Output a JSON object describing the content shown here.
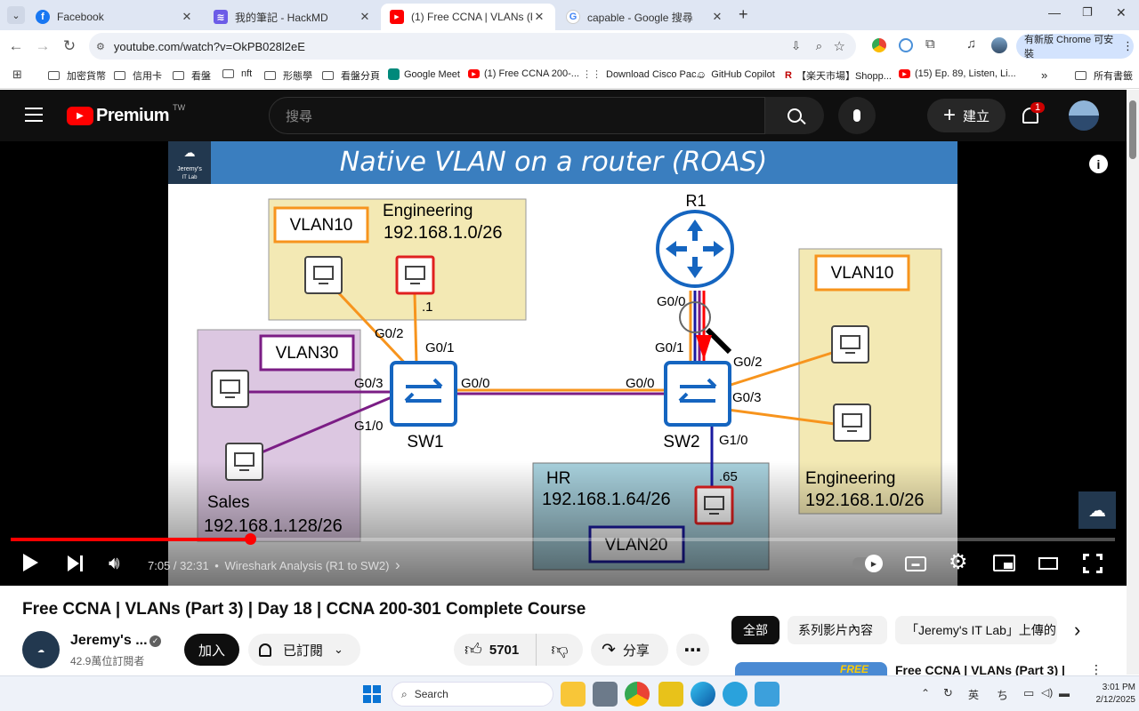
{
  "browser": {
    "tabs": [
      {
        "label": "Facebook",
        "color": "#1877f2",
        "glyph": "f"
      },
      {
        "label": "我的筆記 - HackMD",
        "color": "#6c5ce7",
        "glyph": "≋"
      },
      {
        "label": "(1) Free CCNA | VLANs (Part 3) |",
        "color": "#ff0000",
        "glyph": "▶"
      },
      {
        "label": "capable - Google 搜尋",
        "color": "#4285f4",
        "glyph": "G"
      }
    ],
    "url": "youtube.com/watch?v=OkPB028l2eE",
    "update_button": "有新版 Chrome 可安裝",
    "bookmarks": [
      "加密貨幣",
      "信用卡",
      "看盤",
      "nft",
      "形態學",
      "看盤分頁",
      "Google Meet",
      "(1) Free CCNA 200-...",
      "Download Cisco Pac...",
      "GitHub Copilot",
      "【楽天市場】Shopp...",
      "(15) Ep. 89, Listen, Li..."
    ],
    "all_bookmarks": "所有書籤",
    "more_chevron": "»"
  },
  "youtube": {
    "logo_text": "Premium",
    "region": "TW",
    "search_placeholder": "搜尋",
    "create_label": "建立",
    "notification_count": "1"
  },
  "slide": {
    "title": "Native VLAN on a router (ROAS)",
    "badge_line1": "Jeremy's",
    "badge_line2": "IT Lab",
    "router": "R1",
    "sw1": "SW1",
    "sw2": "SW2",
    "ports": {
      "r1_g00": "G0/0",
      "sw2_g01": "G0/1",
      "sw2_g02": "G0/2",
      "sw2_g03": "G0/3",
      "sw2_g10": "G1/0",
      "sw2_g00": "G0/0",
      "sw1_g00": "G0/0",
      "sw1_g02": "G0/2",
      "sw1_g01": "G0/1",
      "sw1_g03": "G0/3",
      "sw1_g10": "G1/0"
    },
    "eng_left": {
      "vlan": "VLAN10",
      "name": "Engineering",
      "subnet": "192.168.1.0/26",
      "host": ".1"
    },
    "sales": {
      "vlan": "VLAN30",
      "name": "Sales",
      "subnet": "192.168.1.128/26"
    },
    "eng_right": {
      "vlan": "VLAN10",
      "name": "Engineering",
      "subnet": "192.168.1.0/26"
    },
    "hr": {
      "vlan": "VLAN20",
      "name": "HR",
      "subnet": "192.168.1.64/26",
      "host": ".65"
    }
  },
  "player": {
    "time": "7:05 / 32:31",
    "chapter": "Wireshark Analysis (R1 to SW2)",
    "progress": 0.2168,
    "bullet": "•",
    "chevron": "›"
  },
  "video": {
    "title": "Free CCNA | VLANs (Part 3) | Day 18 | CCNA 200-301 Complete Course",
    "channel": "Jeremy's ...",
    "subscribers": "42.9萬位訂閱者",
    "join": "加入",
    "subscribed": "已訂閱",
    "likes": "5701",
    "share": "分享",
    "more": "⋯"
  },
  "chips": [
    "全部",
    "系列影片內容",
    "「Jeremy's IT Lab」上傳的"
  ],
  "related": {
    "title": "Free CCNA | VLANs (Part 3) |",
    "thumb_text": "FREE"
  },
  "taskbar": {
    "search": "Search",
    "ime": "英",
    "time": "3:01 PM",
    "date": "2/12/2025"
  },
  "colors": {
    "accent": "#ff0000",
    "orange": "#f7941d",
    "purple": "#7b1d85",
    "navy": "#1a1aa0",
    "switch_blue": "#1565c0"
  }
}
